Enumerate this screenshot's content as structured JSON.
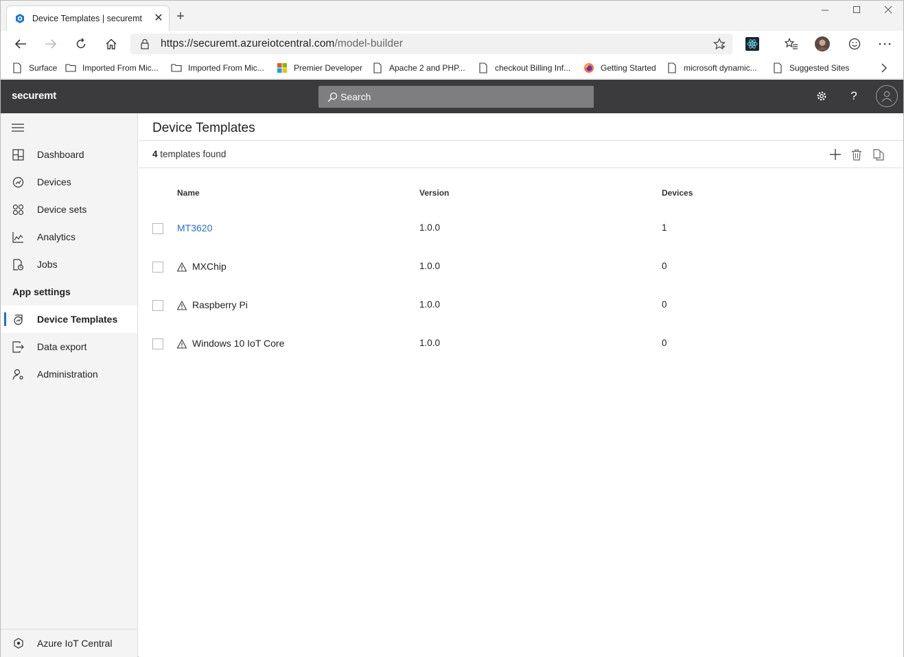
{
  "browser": {
    "tab_title": "Device Templates | securemt",
    "url_host": "https://securemt.azureiotcentral.com",
    "url_path": "/model-builder",
    "favorites": [
      {
        "label": "Surface",
        "icon": "page-icon"
      },
      {
        "label": "Imported From Mic...",
        "icon": "folder-icon"
      },
      {
        "label": "Imported From Mic...",
        "icon": "folder-icon"
      },
      {
        "label": "Premier Developer",
        "icon": "microsoft-logo-icon"
      },
      {
        "label": "Apache 2 and PHP...",
        "icon": "page-icon"
      },
      {
        "label": "checkout Billing Inf...",
        "icon": "page-icon"
      },
      {
        "label": "Getting Started",
        "icon": "firefox-icon"
      },
      {
        "label": "microsoft dynamic...",
        "icon": "page-icon"
      },
      {
        "label": "Suggested Sites",
        "icon": "page-icon"
      }
    ]
  },
  "header": {
    "brand": "securemt",
    "search_placeholder": "Search"
  },
  "sidebar": {
    "items": [
      {
        "label": "Dashboard",
        "icon": "dashboard-icon"
      },
      {
        "label": "Devices",
        "icon": "devices-icon"
      },
      {
        "label": "Device sets",
        "icon": "device-sets-icon"
      },
      {
        "label": "Analytics",
        "icon": "analytics-icon"
      },
      {
        "label": "Jobs",
        "icon": "jobs-icon"
      }
    ],
    "section_label": "App settings",
    "settings_items": [
      {
        "label": "Device Templates",
        "icon": "device-templates-icon",
        "active": true
      },
      {
        "label": "Data export",
        "icon": "data-export-icon"
      },
      {
        "label": "Administration",
        "icon": "administration-icon"
      }
    ],
    "footer_label": "Azure IoT Central"
  },
  "main": {
    "title": "Device Templates",
    "count_number": "4",
    "count_suffix": " templates found",
    "columns": [
      "Name",
      "Version",
      "Devices"
    ],
    "rows": [
      {
        "name": "MT3620",
        "version": "1.0.0",
        "devices": "1",
        "link": true,
        "warning": false
      },
      {
        "name": "MXChip",
        "version": "1.0.0",
        "devices": "0",
        "link": false,
        "warning": true
      },
      {
        "name": "Raspberry Pi",
        "version": "1.0.0",
        "devices": "0",
        "link": false,
        "warning": true
      },
      {
        "name": "Windows 10 IoT Core",
        "version": "1.0.0",
        "devices": "0",
        "link": false,
        "warning": true
      }
    ]
  },
  "colors": {
    "header_bg": "#3b3b3d",
    "accent": "#1f6fd0",
    "sidebar_bg": "#f4f4f4"
  }
}
